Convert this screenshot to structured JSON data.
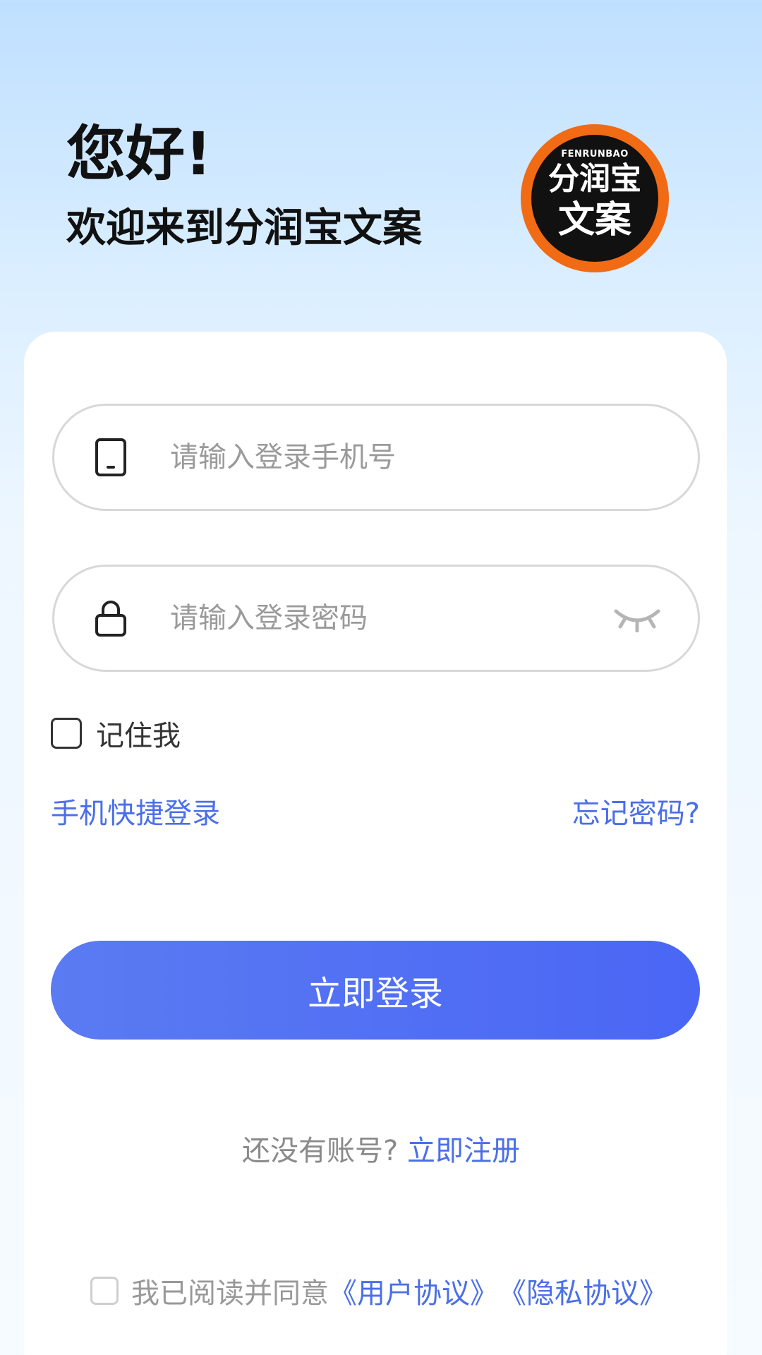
{
  "header": {
    "title": "您好!",
    "subtitle": "欢迎来到分润宝文案"
  },
  "logo": {
    "top_text": "FENRUNBAO",
    "line1": "分润宝",
    "line2": "文案",
    "colors": {
      "ring": "#f16a14",
      "inner": "#111111",
      "text": "#ffffff"
    }
  },
  "form": {
    "phone": {
      "placeholder": "请输入登录手机号",
      "icon": "phone-icon"
    },
    "password": {
      "placeholder": "请输入登录密码",
      "icon": "lock-icon",
      "toggle_icon": "eye-closed-icon"
    },
    "remember": {
      "label": "记住我",
      "checked": false
    },
    "quick_login": "手机快捷登录",
    "forgot_password": "忘记密码?",
    "submit": "立即登录"
  },
  "register": {
    "prompt": "还没有账号?",
    "link": "立即注册"
  },
  "agreement": {
    "checked": false,
    "text": "我已阅读并同意",
    "user_agreement": "《用户协议》",
    "privacy_agreement": "《隐私协议》"
  },
  "colors": {
    "accent": "#4b6fe8",
    "button_start": "#5a7bf2",
    "button_end": "#4a66f5"
  }
}
